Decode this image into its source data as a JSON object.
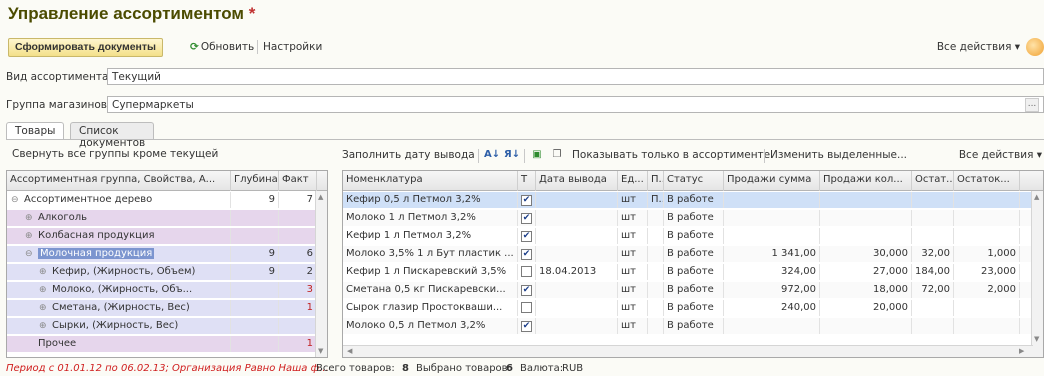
{
  "window": {
    "title": "Управление ассортиментом",
    "modified_mark": "*"
  },
  "toolbar": {
    "generate_label": "Сформировать документы",
    "refresh_label": "Обновить",
    "settings_label": "Настройки",
    "all_actions_label": "Все действия ▾"
  },
  "fields": {
    "assortment_type": {
      "label": "Вид ассортимента:",
      "value": "Текущий"
    },
    "store_group": {
      "label": "Группа магазинов:",
      "value": "Супермаркеты",
      "select_btn": "..."
    }
  },
  "tabs": [
    {
      "label": "Товары",
      "active": true
    },
    {
      "label": "Список документов",
      "active": false
    }
  ],
  "left_panel": {
    "collapse_label": "Свернуть все группы кроме текущей",
    "columns": [
      "Ассортиментная группа, Свойства, А...",
      "Глубина",
      "Факт"
    ],
    "rows": [
      {
        "icon": "⊖",
        "level": 0,
        "name": "Ассортиментное дерево",
        "depth": "9",
        "fact": "7",
        "fact_red": false,
        "bg": "#ffffff",
        "highlight": false
      },
      {
        "icon": "⊕",
        "level": 1,
        "name": "Алкоголь",
        "depth": "",
        "fact": "",
        "fact_red": false,
        "bg": "#e6d6ec",
        "highlight": false
      },
      {
        "icon": "⊕",
        "level": 1,
        "name": "Колбасная продукция",
        "depth": "",
        "fact": "",
        "fact_red": false,
        "bg": "#e6d6ec",
        "highlight": false
      },
      {
        "icon": "⊖",
        "level": 1,
        "name": "Молочная продукция",
        "depth": "9",
        "fact": "6",
        "fact_red": false,
        "bg": "#dfe0f5",
        "highlight": true
      },
      {
        "icon": "⊕",
        "level": 2,
        "name": "Кефир, (Жирность, Объем)",
        "depth": "9",
        "fact": "2",
        "fact_red": false,
        "bg": "#dfe0f5",
        "highlight": false
      },
      {
        "icon": "⊕",
        "level": 2,
        "name": "Молоко, (Жирность, Объ...",
        "depth": "",
        "fact": "3",
        "fact_red": true,
        "bg": "#dfe0f5",
        "highlight": false
      },
      {
        "icon": "⊕",
        "level": 2,
        "name": "Сметана, (Жирность, Вес)",
        "depth": "",
        "fact": "1",
        "fact_red": true,
        "bg": "#dfe0f5",
        "highlight": false
      },
      {
        "icon": "⊕",
        "level": 2,
        "name": "Сырки, (Жирность, Вес)",
        "depth": "",
        "fact": "",
        "fact_red": false,
        "bg": "#dfe0f5",
        "highlight": false
      },
      {
        "icon": "",
        "level": 1,
        "name": "Прочее",
        "depth": "",
        "fact": "1",
        "fact_red": true,
        "bg": "#e6d6ec",
        "highlight": false
      }
    ]
  },
  "right_panel": {
    "fill_date_label": "Заполнить дату вывода",
    "only_assortment_label": "Показывать только в ассортименте",
    "change_selected_label": "Изменить выделенные...",
    "all_actions_label": "Все действия ▾",
    "columns": [
      "Номенклатура",
      "Т",
      "Дата вывода",
      "Ед...",
      "П...",
      "Статус",
      "Продажи сумма",
      "Продажи кол...",
      "Остат...",
      "Остаток..."
    ],
    "rows": [
      {
        "name": "Кефир 0,5 л  Петмол 3,2%",
        "checked": true,
        "date": "",
        "unit": "шт",
        "p": "П...",
        "status": "В работе",
        "sales_sum": "",
        "sales_qty": "",
        "rest1": "",
        "rest2": "",
        "selected": true
      },
      {
        "name": "Молоко 1 л  Петмол 3,2%",
        "checked": true,
        "date": "",
        "unit": "шт",
        "p": "",
        "status": "В работе",
        "sales_sum": "",
        "sales_qty": "",
        "rest1": "",
        "rest2": "",
        "selected": false
      },
      {
        "name": "Кефир 1 л  Петмол 3,2%",
        "checked": true,
        "date": "",
        "unit": "шт",
        "p": "",
        "status": "В работе",
        "sales_sum": "",
        "sales_qty": "",
        "rest1": "",
        "rest2": "",
        "selected": false
      },
      {
        "name": "Молоко 3,5% 1 л Бут пластик ...",
        "checked": true,
        "date": "",
        "unit": "шт",
        "p": "",
        "status": "В работе",
        "sales_sum": "1 341,00",
        "sales_qty": "30,000",
        "rest1": "32,00",
        "rest2": "1,000",
        "selected": false
      },
      {
        "name": "Кефир 1 л  Пискаревский 3,5%",
        "checked": false,
        "date": "18.04.2013",
        "unit": "шт",
        "p": "",
        "status": "В работе",
        "sales_sum": "324,00",
        "sales_qty": "27,000",
        "rest1": "184,00",
        "rest2": "23,000",
        "selected": false
      },
      {
        "name": "Сметана 0,5 кг  Пискаревски...",
        "checked": true,
        "date": "",
        "unit": "шт",
        "p": "",
        "status": "В работе",
        "sales_sum": "972,00",
        "sales_qty": "18,000",
        "rest1": "72,00",
        "rest2": "2,000",
        "selected": false
      },
      {
        "name": "Сырок глазир  Простокваши...",
        "checked": false,
        "date": "",
        "unit": "шт",
        "p": "",
        "status": "В работе",
        "sales_sum": "240,00",
        "sales_qty": "20,000",
        "rest1": "",
        "rest2": "",
        "selected": false
      },
      {
        "name": "Молоко 0,5 л  Петмол 3,2%",
        "checked": true,
        "date": "",
        "unit": "шт",
        "p": "",
        "status": "В работе",
        "sales_sum": "",
        "sales_qty": "",
        "rest1": "",
        "rest2": "",
        "selected": false
      }
    ]
  },
  "status_bar": {
    "period_text": "Период с 01.01.12 по 06.02.13; Организация Равно Наша ф...",
    "total_label": "Всего товаров:",
    "total_value": "8",
    "selected_label": "Выбрано товаров:",
    "selected_value": "6",
    "currency_label": "Валюта:",
    "currency_value": "RUB"
  },
  "colors": {
    "accent": "#4b4b00",
    "selection": "#cfe0f7",
    "highlight": "#7c95cf",
    "warning": "#c02020"
  }
}
